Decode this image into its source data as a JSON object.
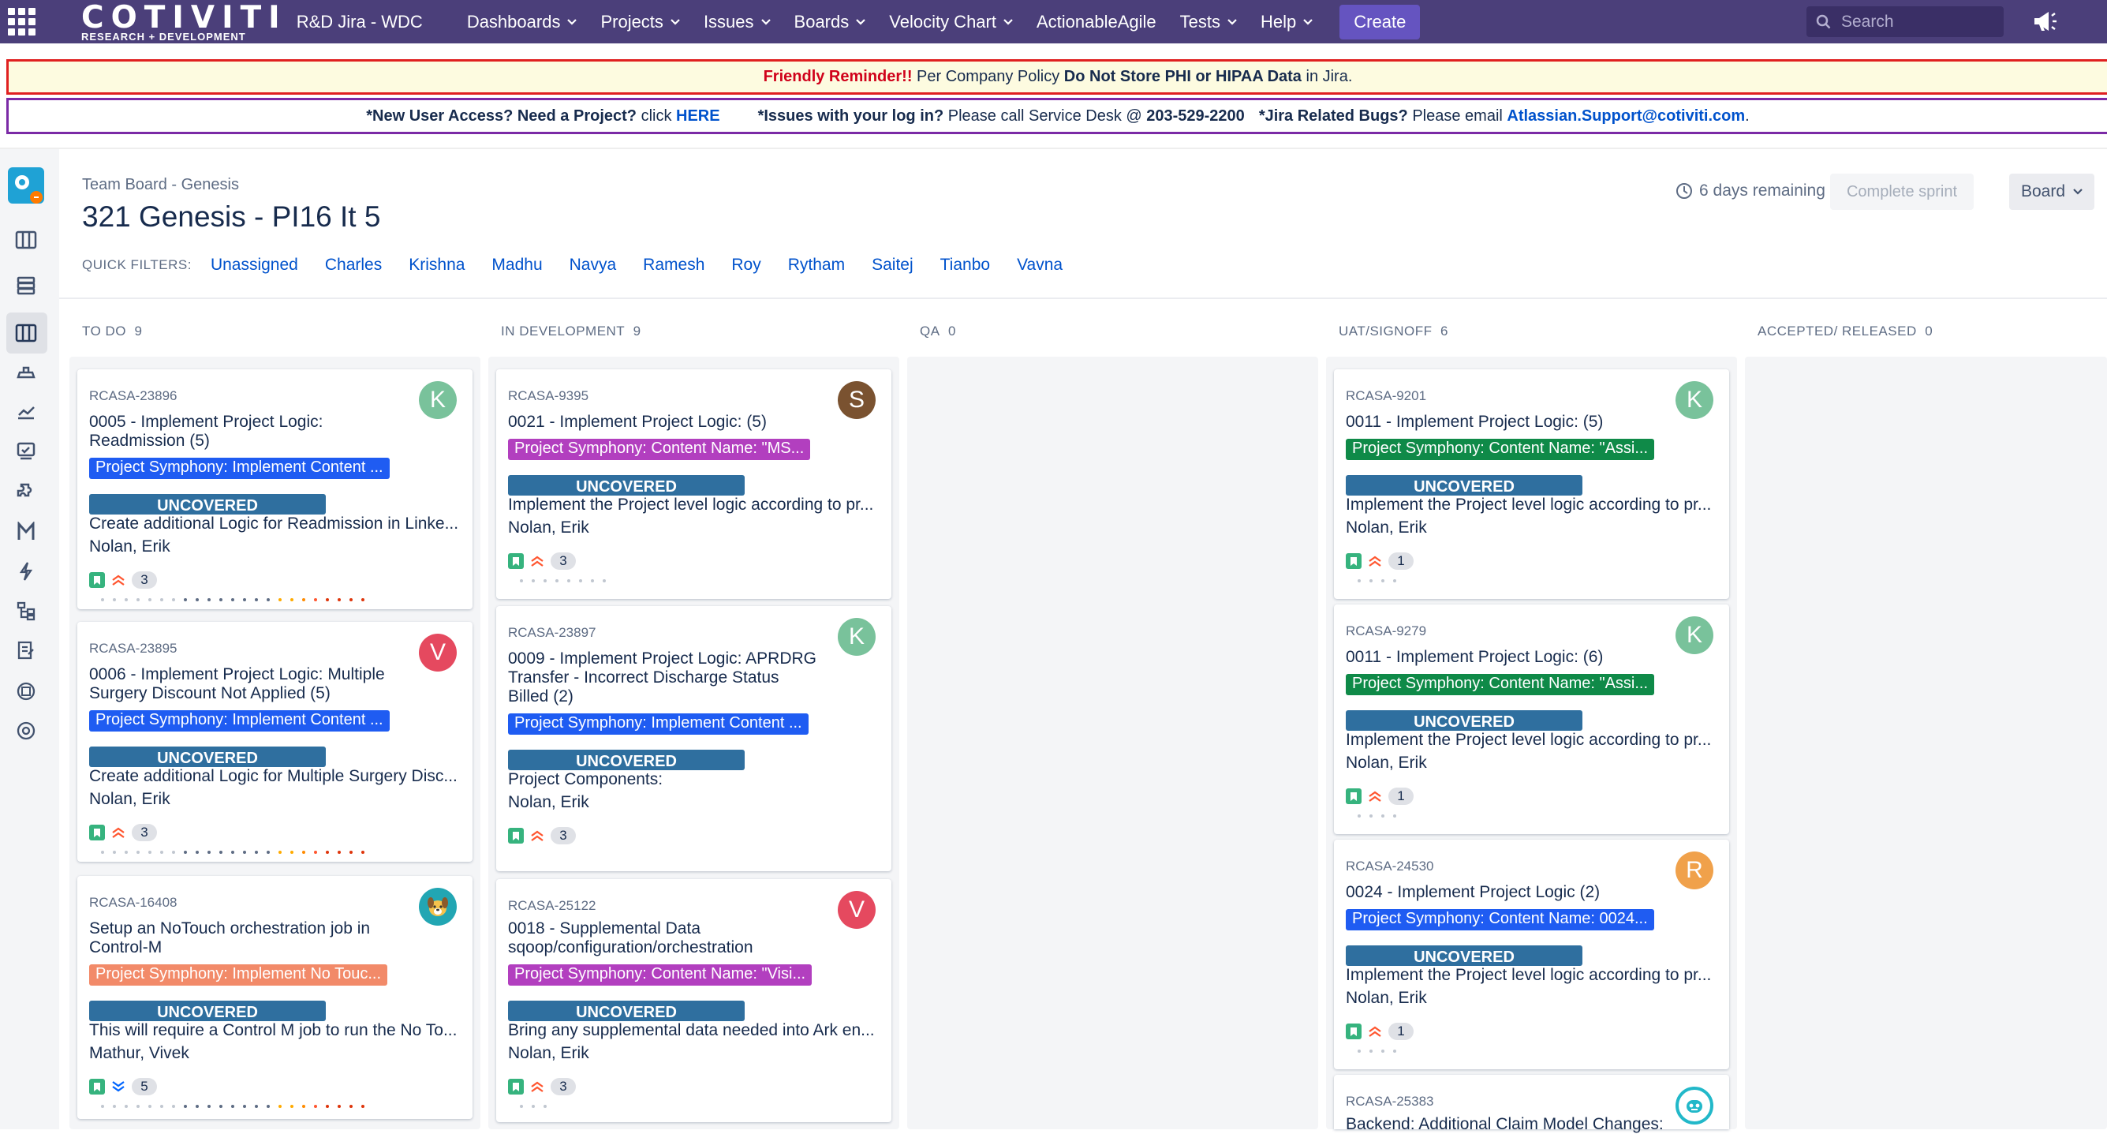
{
  "topnav": {
    "logo_big": "COTIVITI",
    "logo_small": "RESEARCH + DEVELOPMENT",
    "site": "R&D Jira - WDC",
    "menus": [
      "Dashboards",
      "Projects",
      "Issues",
      "Boards",
      "Velocity Chart"
    ],
    "actionable": "ActionableAgile",
    "menus2": [
      "Tests",
      "Help"
    ],
    "create": "Create",
    "search_placeholder": "Search"
  },
  "banner1": {
    "reminder": "Friendly Reminder!!",
    "policy": " Per Company Policy ",
    "dont": "Do Not Store PHI or HIPAA Data",
    "in": " in Jira."
  },
  "banner2": {
    "new_user": "*New User Access? Need a Project?",
    "click": " click ",
    "here": "HERE",
    "issues": "*Issues with your log in?",
    "call": " Please call Service Desk @ ",
    "phone": "203-529-2200",
    "bugs": "*Jira Related Bugs?",
    "email": " Please email ",
    "address": "Atlassian.Support@cotiviti.com",
    "dot": "."
  },
  "board": {
    "breadcrumb": "Team Board - Genesis",
    "title": "321 Genesis - PI16 It 5",
    "quick_filters_label": "QUICK FILTERS:",
    "filters": [
      "Unassigned",
      "Charles",
      "Krishna",
      "Madhu",
      "Navya",
      "Ramesh",
      "Roy",
      "Rytham",
      "Saitej",
      "Tianbo",
      "Vavna"
    ],
    "remaining": "6 days remaining",
    "complete_sprint": "Complete sprint",
    "board_button": "Board"
  },
  "columns": [
    {
      "name": "TO DO",
      "count": "9"
    },
    {
      "name": "IN DEVELOPMENT",
      "count": "9"
    },
    {
      "name": "QA",
      "count": "0"
    },
    {
      "name": "UAT/SIGNOFF",
      "count": "6"
    },
    {
      "name": "ACCEPTED/ RELEASED",
      "count": "0"
    }
  ],
  "colors": {
    "green_avatar": "#79c29b",
    "red_avatar": "#e5495f",
    "orange_avatar": "#f0a14b",
    "brown_avatar": "#7a5230",
    "epic_blue": "#1f5cf2",
    "epic_magenta": "#b23fbf",
    "epic_green": "#0f8a48",
    "epic_salmon": "#f28a69"
  },
  "cards": {
    "todo": [
      {
        "key": "RCASA-23896",
        "summary": "0005 - Implement Project Logic: Readmission (5)",
        "avatar": "K",
        "epic": "Project Symphony: Implement Content ...",
        "label": "UNCOVERED",
        "desc": "Create additional Logic for Readmission in Linke...",
        "assignee": "Nolan, Erik",
        "estimate": "3"
      },
      {
        "key": "RCASA-23895",
        "summary": "0006 - Implement Project Logic: Multiple Surgery Discount Not Applied (5)",
        "avatar": "V",
        "epic": "Project Symphony: Implement Content ...",
        "label": "UNCOVERED",
        "desc": "Create additional Logic for Multiple Surgery Disc...",
        "assignee": "Nolan, Erik",
        "estimate": "3"
      },
      {
        "key": "RCASA-16408",
        "summary": "Setup an NoTouch orchestration job in Control-M",
        "avatar": "",
        "epic": "Project Symphony: Implement No Touc...",
        "label": "UNCOVERED",
        "desc": "This will require a Control M job to run the No To...",
        "assignee": "Mathur, Vivek",
        "estimate": "5"
      }
    ],
    "dev": [
      {
        "key": "RCASA-9395",
        "summary": "0021 - Implement Project Logic: (5)",
        "avatar": "S",
        "epic": "Project Symphony: Content Name: \"MS...",
        "label": "UNCOVERED",
        "desc": "Implement the Project level logic according to pr...",
        "assignee": "Nolan, Erik",
        "estimate": "3"
      },
      {
        "key": "RCASA-23897",
        "summary": "0009 - Implement Project Logic: APRDRG Transfer - Incorrect Discharge Status Billed (2)",
        "avatar": "K",
        "epic": "Project Symphony: Implement Content ...",
        "label": "UNCOVERED",
        "desc": "Project Components:",
        "assignee": "Nolan, Erik",
        "estimate": "3"
      },
      {
        "key": "RCASA-25122",
        "summary": "0018 - Supplemental Data sqoop/configuration/orchestration",
        "avatar": "V",
        "epic": "Project Symphony: Content Name: \"Visi...",
        "label": "UNCOVERED",
        "desc": "Bring any supplemental data needed into Ark en...",
        "assignee": "Nolan, Erik",
        "estimate": "3"
      }
    ],
    "uat": [
      {
        "key": "RCASA-9201",
        "summary": "0011 - Implement Project Logic: (5)",
        "avatar": "K",
        "epic": "Project Symphony: Content Name: \"Assi...",
        "label": "UNCOVERED",
        "desc": "Implement the Project level logic according to pr...",
        "assignee": "Nolan, Erik",
        "estimate": "1"
      },
      {
        "key": "RCASA-9279",
        "summary": "0011 - Implement Project Logic: (6)",
        "avatar": "K",
        "epic": "Project Symphony: Content Name: \"Assi...",
        "label": "UNCOVERED",
        "desc": "Implement the Project level logic according to pr...",
        "assignee": "Nolan, Erik",
        "estimate": "1"
      },
      {
        "key": "RCASA-24530",
        "summary": "0024 - Implement Project Logic (2)",
        "avatar": "R",
        "epic": "Project Symphony: Content Name: 0024...",
        "label": "UNCOVERED",
        "desc": "Implement the Project level logic according to pr...",
        "assignee": "Nolan, Erik",
        "estimate": "1"
      },
      {
        "key": "RCASA-25383",
        "summary": "Backend: Additional Claim Model Changes:",
        "avatar": ""
      }
    ]
  }
}
